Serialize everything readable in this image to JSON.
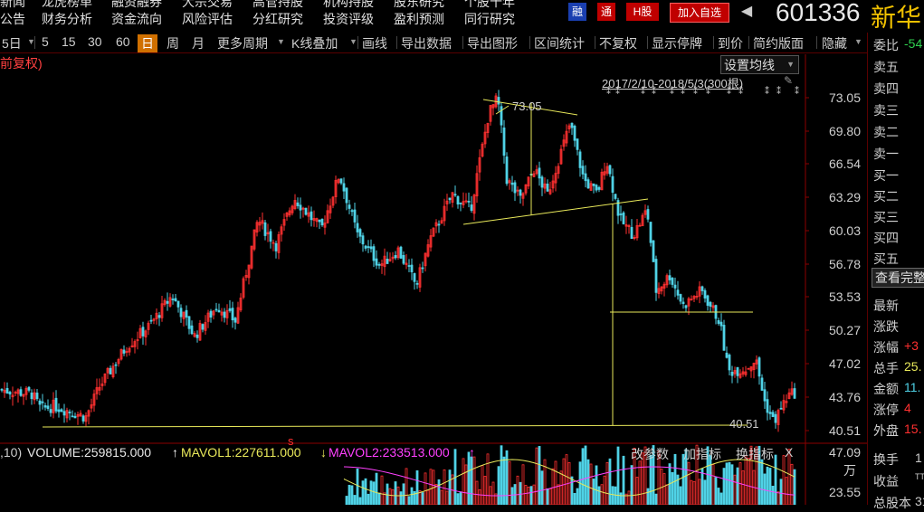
{
  "menu": {
    "top_row": [
      "新闻",
      "龙虎榜单",
      "融资融券",
      "大宗交易",
      "高管持股",
      "机构持股",
      "股东研究",
      "个股十年"
    ],
    "bottom_row": [
      "公告",
      "财务分析",
      "资金流向",
      "风险评估",
      "分红研究",
      "投资评级",
      "盈利预测",
      "同行研究"
    ],
    "badges": [
      "融",
      "通",
      "H股"
    ],
    "add_watch": "加入自选",
    "back_arrow": "◀"
  },
  "stock": {
    "code": "601336",
    "name": "新华"
  },
  "toolbar": {
    "items": [
      "5日",
      "5",
      "15",
      "30",
      "60",
      "日",
      "周",
      "月",
      "更多周期",
      "K线叠加",
      "画线",
      "导出数据",
      "导出图形",
      "区间统计",
      "不复权",
      "显示停牌",
      "到价",
      "简约版面",
      "隐藏"
    ],
    "selected": "日"
  },
  "chart": {
    "adjust_label": "前复权)",
    "ma_settings": "设置均线",
    "range_label": "2017/2/10-2018/5/3(300根)",
    "high_label": "73.05",
    "low_label": "40.51",
    "colors": {
      "up": "#ff3030",
      "down": "#4fd2e6",
      "line": "#e8e85a",
      "axis": "#8b0000"
    },
    "price_axis": [
      "73.05",
      "69.80",
      "66.54",
      "63.29",
      "60.03",
      "56.78",
      "53.53",
      "50.27",
      "47.02",
      "43.76",
      "40.51"
    ],
    "vol_axis": [
      "47.09",
      "万",
      "23.55"
    ],
    "marker": "s"
  },
  "right_panel": {
    "weibi_label": "委比",
    "weibi_value": "-54",
    "sell_levels": [
      "卖五",
      "卖四",
      "卖三",
      "卖二",
      "卖一"
    ],
    "buy_levels": [
      "买一",
      "买二",
      "买三",
      "买四",
      "买五"
    ],
    "detail_button": "查看完整",
    "stats": [
      {
        "label": "最新",
        "value": ""
      },
      {
        "label": "涨跌",
        "value": ""
      },
      {
        "label": "涨幅",
        "value": "+3"
      },
      {
        "label": "总手",
        "value": "25."
      },
      {
        "label": "金额",
        "value": "11."
      },
      {
        "label": "涨停",
        "value": "4"
      },
      {
        "label": "外盘",
        "value": "15."
      }
    ],
    "stats2": [
      {
        "label": "换手",
        "value": "1"
      },
      {
        "label": "收益",
        "value": "TTM"
      },
      {
        "label": "总股本",
        "value": "31"
      }
    ]
  },
  "volume": {
    "period": ",10)",
    "volume": "VOLUME:259815.000",
    "mavol1": "MAVOL1:227611.000",
    "mavol2": "MAVOL2:233513.000",
    "buttons": [
      "改参数",
      "加指标",
      "换指标",
      "X"
    ]
  }
}
